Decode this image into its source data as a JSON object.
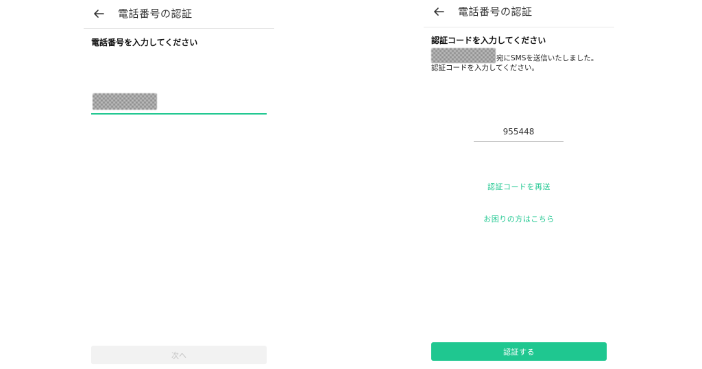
{
  "left_screen": {
    "header": {
      "title": "電話番号の認証",
      "back_icon": "arrow-left-icon"
    },
    "prompt": "電話番号を入力してください",
    "phone_input": {
      "value_redacted": true
    },
    "next_button": {
      "label": "次へ",
      "enabled": false
    }
  },
  "right_screen": {
    "header": {
      "title": "電話番号の認証",
      "back_icon": "arrow-left-icon"
    },
    "prompt": "認証コードを入力してください",
    "sms_note": {
      "line1_suffix": "宛にSMSを送信いたしました。",
      "line2": "認証コードを入力してください。"
    },
    "code_input": {
      "value": "955448"
    },
    "resend_link": "認証コードを再送",
    "help_link": "お困りの方はこちら",
    "verify_button": {
      "label": "認証する",
      "enabled": true
    }
  },
  "colors": {
    "accent": "#1fc790",
    "disabled_bg": "#f2f2f2",
    "disabled_text": "#c4c4c4",
    "divider": "#e6e6e6"
  }
}
